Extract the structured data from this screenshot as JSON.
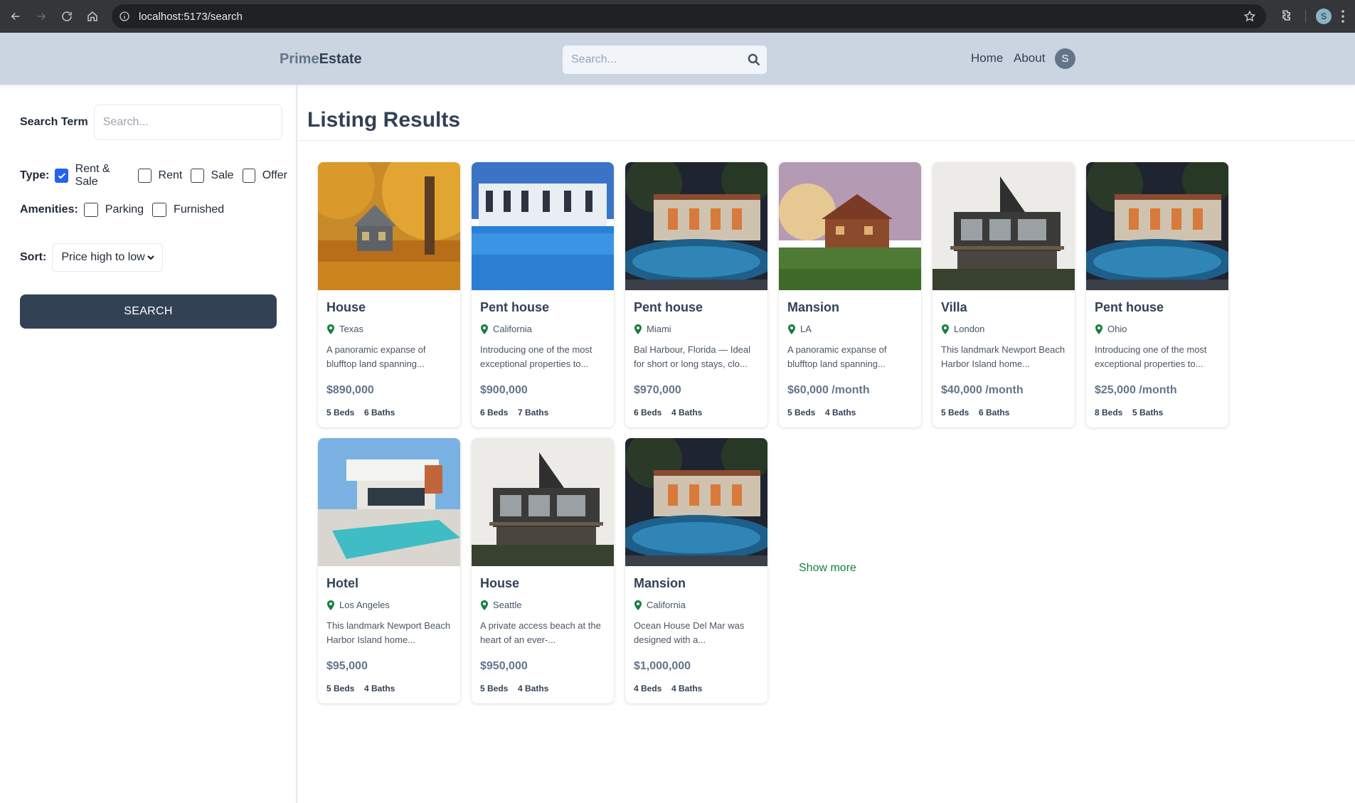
{
  "browser": {
    "url": "localhost:5173/search",
    "profile_initial": "S"
  },
  "header": {
    "logo_part1": "Prime",
    "logo_part2": "Estate",
    "search_placeholder": "Search...",
    "nav": [
      "Home",
      "About"
    ],
    "avatar_initial": "S"
  },
  "sidebar": {
    "term_label": "Search Term",
    "term_placeholder": "Search...",
    "type_label": "Type:",
    "types": [
      {
        "label": "Rent & Sale",
        "checked": true
      },
      {
        "label": "Rent",
        "checked": false
      },
      {
        "label": "Sale",
        "checked": false
      },
      {
        "label": "Offer",
        "checked": false
      }
    ],
    "amenities_label": "Amenities:",
    "amenities": [
      {
        "label": "Parking",
        "checked": false
      },
      {
        "label": "Furnished",
        "checked": false
      }
    ],
    "sort_label": "Sort:",
    "sort_value": "Price high to low",
    "search_button": "SEARCH"
  },
  "main": {
    "title": "Listing Results",
    "show_more": "Show more",
    "listings": [
      {
        "title": "House",
        "location": "Texas",
        "desc": "A panoramic expanse of blufftop land spanning...",
        "price": "$890,000",
        "beds": "5 Beds",
        "baths": "6 Baths",
        "image": "autumn-house"
      },
      {
        "title": "Pent house",
        "location": "California",
        "desc": "Introducing one of the most exceptional properties to...",
        "price": "$900,000",
        "beds": "6 Beds",
        "baths": "7 Baths",
        "image": "pool-white-building"
      },
      {
        "title": "Pent house",
        "location": "Miami",
        "desc": "Bal Harbour, Florida — Ideal for short or long stays, clo...",
        "price": "$970,000",
        "beds": "6 Beds",
        "baths": "4 Baths",
        "image": "night-pool-villa"
      },
      {
        "title": "Mansion",
        "location": "LA",
        "desc": "A panoramic expanse of blufftop land spanning...",
        "price": "$60,000 /month",
        "beds": "5 Beds",
        "baths": "4 Baths",
        "image": "sunset-wood-house"
      },
      {
        "title": "Villa",
        "location": "London",
        "desc": "This landmark Newport Beach Harbor Island home...",
        "price": "$40,000 /month",
        "beds": "5 Beds",
        "baths": "6 Baths",
        "image": "modern-gray-house"
      },
      {
        "title": "Pent house",
        "location": "Ohio",
        "desc": "Introducing one of the most exceptional properties to...",
        "price": "$25,000 /month",
        "beds": "8 Beds",
        "baths": "5 Baths",
        "image": "night-pool-villa"
      },
      {
        "title": "Hotel",
        "location": "Los Angeles",
        "desc": "This landmark Newport Beach Harbor Island home...",
        "price": "$95,000",
        "beds": "5 Beds",
        "baths": "4 Baths",
        "image": "modern-white-pool"
      },
      {
        "title": "House",
        "location": "Seattle",
        "desc": "A private access beach at the heart of an ever-...",
        "price": "$950,000",
        "beds": "5 Beds",
        "baths": "4 Baths",
        "image": "modern-gray-house"
      },
      {
        "title": "Mansion",
        "location": "California",
        "desc": "Ocean House Del Mar was designed with a...",
        "price": "$1,000,000",
        "beds": "4 Beds",
        "baths": "4 Baths",
        "image": "night-pool-villa"
      }
    ]
  },
  "colors": {
    "header_bg": "#cbd5e1",
    "primary": "#334155",
    "accent_green": "#15803d",
    "checkbox_blue": "#2563eb"
  }
}
